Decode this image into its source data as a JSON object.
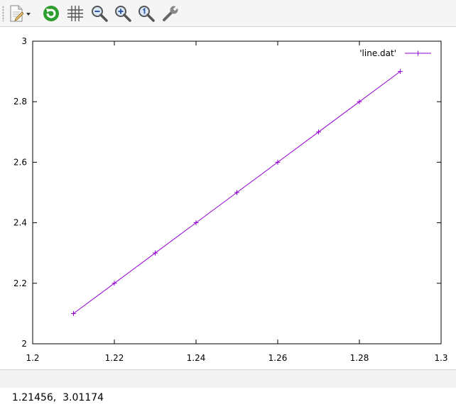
{
  "toolbar": {
    "icons": [
      "export-icon",
      "dropdown-arrow-icon",
      "replot-icon",
      "grid-icon",
      "zoom-out-icon",
      "zoom-in-icon",
      "zoom-reset-icon",
      "settings-wrench-icon"
    ]
  },
  "status": {
    "coordinates": "1.21456,  3.01174"
  },
  "chart_data": {
    "type": "line",
    "series": [
      {
        "name": "'line.dat'",
        "x": [
          1.21,
          1.22,
          1.23,
          1.24,
          1.25,
          1.26,
          1.27,
          1.28,
          1.29
        ],
        "y": [
          2.1,
          2.2,
          2.3,
          2.4,
          2.5,
          2.6,
          2.7,
          2.8,
          2.9
        ],
        "color": "#9400d3",
        "marker": "plus"
      }
    ],
    "xlim": [
      1.2,
      1.3
    ],
    "ylim": [
      2,
      3
    ],
    "xticks": [
      "1.2",
      "1.22",
      "1.24",
      "1.26",
      "1.28",
      "1.3"
    ],
    "yticks": [
      "2",
      "2.2",
      "2.4",
      "2.6",
      "2.8",
      "3"
    ],
    "legend_position": "top-right",
    "grid": false
  }
}
